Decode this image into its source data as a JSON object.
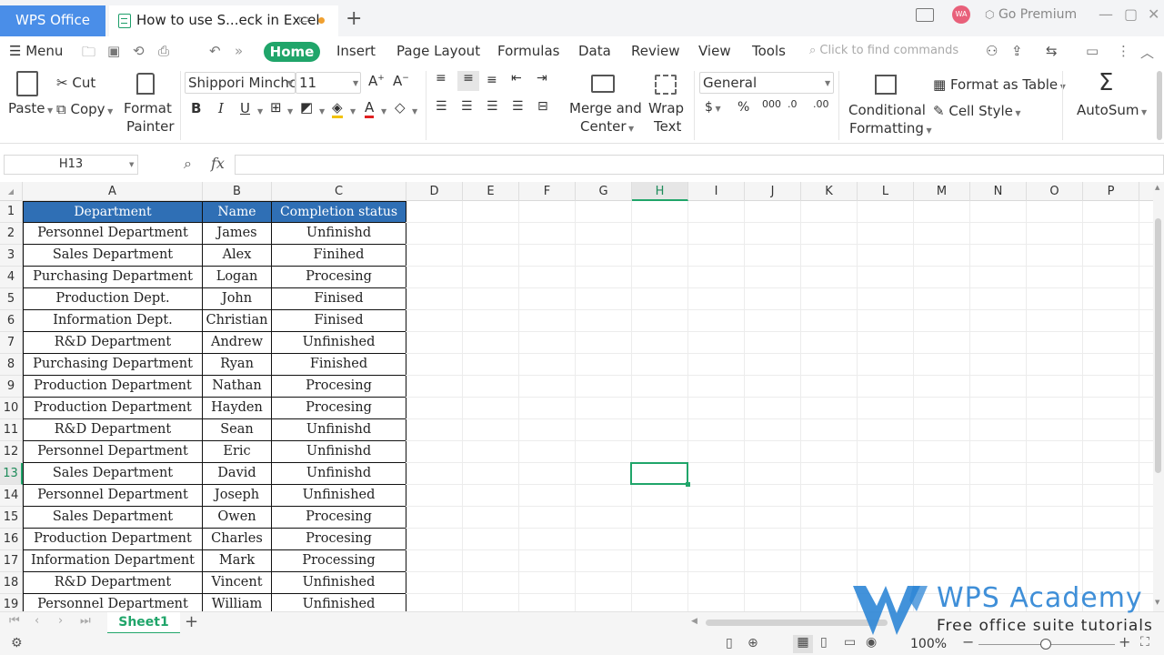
{
  "titlebar": {
    "app_tab": "WPS Office",
    "doc_tab": "How to use S...eck in Excel",
    "new_tab": "+",
    "go_premium": "Go Premium",
    "avatar": "WA"
  },
  "menu": {
    "menu_label": "Menu",
    "tabs": [
      "Home",
      "Insert",
      "Page Layout",
      "Formulas",
      "Data",
      "Review",
      "View",
      "Tools"
    ],
    "search_placeholder": "Click to find commands"
  },
  "ribbon": {
    "paste": "Paste",
    "cut": "Cut",
    "copy": "Copy",
    "format_painter_1": "Format",
    "format_painter_2": "Painter",
    "font_name": "Shippori Minchc",
    "font_size": "11",
    "merge_1": "Merge and",
    "merge_2": "Center",
    "wrap_1": "Wrap",
    "wrap_2": "Text",
    "number_format": "General",
    "conditional_1": "Conditional",
    "conditional_2": "Formatting",
    "format_as_table": "Format as Table",
    "cell_style": "Cell Style",
    "autosum": "AutoSum"
  },
  "formula_bar": {
    "name_box": "H13",
    "fx": "fx",
    "value": ""
  },
  "sheet": {
    "columns": [
      "A",
      "B",
      "C",
      "D",
      "E",
      "F",
      "G",
      "H",
      "I",
      "J",
      "K",
      "L",
      "M",
      "N",
      "O",
      "P"
    ],
    "active_column": "H",
    "active_row": "13",
    "rows": [
      {
        "num": "1",
        "cells": [
          "Department",
          "Name",
          "Completion status"
        ]
      },
      {
        "num": "2",
        "cells": [
          "Personnel Department",
          "James",
          "Unfinishd"
        ]
      },
      {
        "num": "3",
        "cells": [
          "Sales Department",
          "Alex",
          "Finihed"
        ]
      },
      {
        "num": "4",
        "cells": [
          "Purchasing Department",
          "Logan",
          "Procesing"
        ]
      },
      {
        "num": "5",
        "cells": [
          "Production Dept.",
          "John",
          "Finised"
        ]
      },
      {
        "num": "6",
        "cells": [
          "Information Dept.",
          "Christian",
          "Finised"
        ]
      },
      {
        "num": "7",
        "cells": [
          "R&D Department",
          "Andrew",
          "Unfinished"
        ]
      },
      {
        "num": "8",
        "cells": [
          "Purchasing Department",
          "Ryan",
          "Finished"
        ]
      },
      {
        "num": "9",
        "cells": [
          "Production Department",
          "Nathan",
          "Procesing"
        ]
      },
      {
        "num": "10",
        "cells": [
          "Production Department",
          "Hayden",
          "Procesing"
        ]
      },
      {
        "num": "11",
        "cells": [
          "R&D Department",
          "Sean",
          "Unfinishd"
        ]
      },
      {
        "num": "12",
        "cells": [
          "Personnel Department",
          "Eric",
          "Unfinishd"
        ]
      },
      {
        "num": "13",
        "cells": [
          "Sales Department",
          "David",
          "Unfinishd"
        ]
      },
      {
        "num": "14",
        "cells": [
          "Personnel Department",
          "Joseph",
          "Unfinished"
        ]
      },
      {
        "num": "15",
        "cells": [
          "Sales Department",
          "Owen",
          "Procesing"
        ]
      },
      {
        "num": "16",
        "cells": [
          "Production Department",
          "Charles",
          "Procesing"
        ]
      },
      {
        "num": "17",
        "cells": [
          "Information Department",
          "Mark",
          "Processing"
        ]
      },
      {
        "num": "18",
        "cells": [
          "R&D Department",
          "Vincent",
          "Unfinished"
        ]
      },
      {
        "num": "19",
        "cells": [
          "Personnel Department",
          "William",
          "Unfinished"
        ]
      }
    ]
  },
  "tabs_bar": {
    "sheet_name": "Sheet1",
    "add_sheet": "+"
  },
  "status": {
    "zoom": "100%"
  },
  "watermark": {
    "title": "WPS Academy",
    "subtitle": "Free office suite tutorials"
  },
  "colors": {
    "accent_green": "#20a56a",
    "header_blue": "#2f6fb5",
    "wps_blue": "#4a8ee8"
  }
}
